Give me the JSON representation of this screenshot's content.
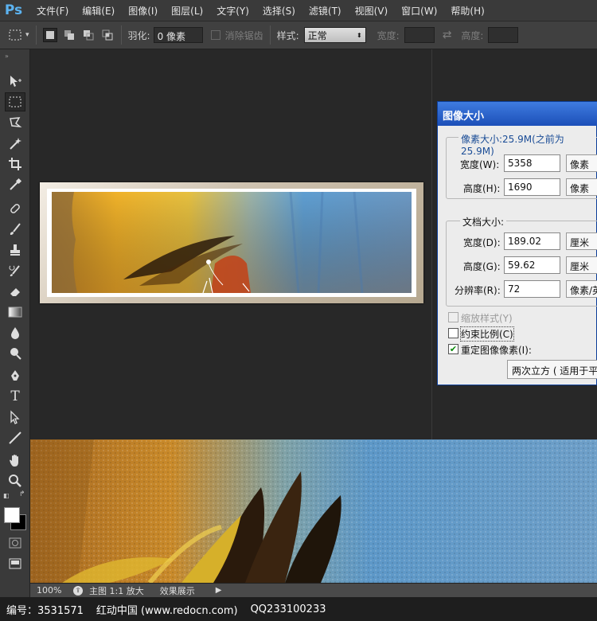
{
  "app": {
    "logo": "Ps"
  },
  "menu": [
    "文件(F)",
    "编辑(E)",
    "图像(I)",
    "图层(L)",
    "文字(Y)",
    "选择(S)",
    "滤镜(T)",
    "视图(V)",
    "窗口(W)",
    "帮助(H)"
  ],
  "options": {
    "feather_label": "羽化:",
    "feather_value": "0 像素",
    "antialias_label": "消除锯齿",
    "style_label": "样式:",
    "style_value": "正常",
    "width_label": "宽度:",
    "height_label": "高度:"
  },
  "dialog": {
    "title": "图像大小",
    "pixel_dim_label": "像素大小:25.9M(之前为25.9M)",
    "px_width_label": "宽度(W):",
    "px_width_value": "5358",
    "px_width_unit": "像素",
    "px_height_label": "高度(H):",
    "px_height_value": "1690",
    "px_height_unit": "像素",
    "doc_size_label": "文档大小:",
    "doc_width_label": "宽度(D):",
    "doc_width_value": "189.02",
    "doc_width_unit": "厘米",
    "doc_height_label": "高度(G):",
    "doc_height_value": "59.62",
    "doc_height_unit": "厘米",
    "resolution_label": "分辨率(R):",
    "resolution_value": "72",
    "resolution_unit": "像素/英",
    "scale_styles": "缩放样式(Y)",
    "constrain": "约束比例(C)",
    "resample": "重定图像像素(I):",
    "resample_method": "两次立方 ( 适用于平"
  },
  "status": {
    "zoom": "100%",
    "doc_info": "主图 1:1 放大",
    "effect": "效果展示"
  },
  "footer": {
    "id_text": "编号：3531571",
    "site_text": "红动中国 (www.redocn.com)",
    "qq_text": "QQ233100233"
  }
}
